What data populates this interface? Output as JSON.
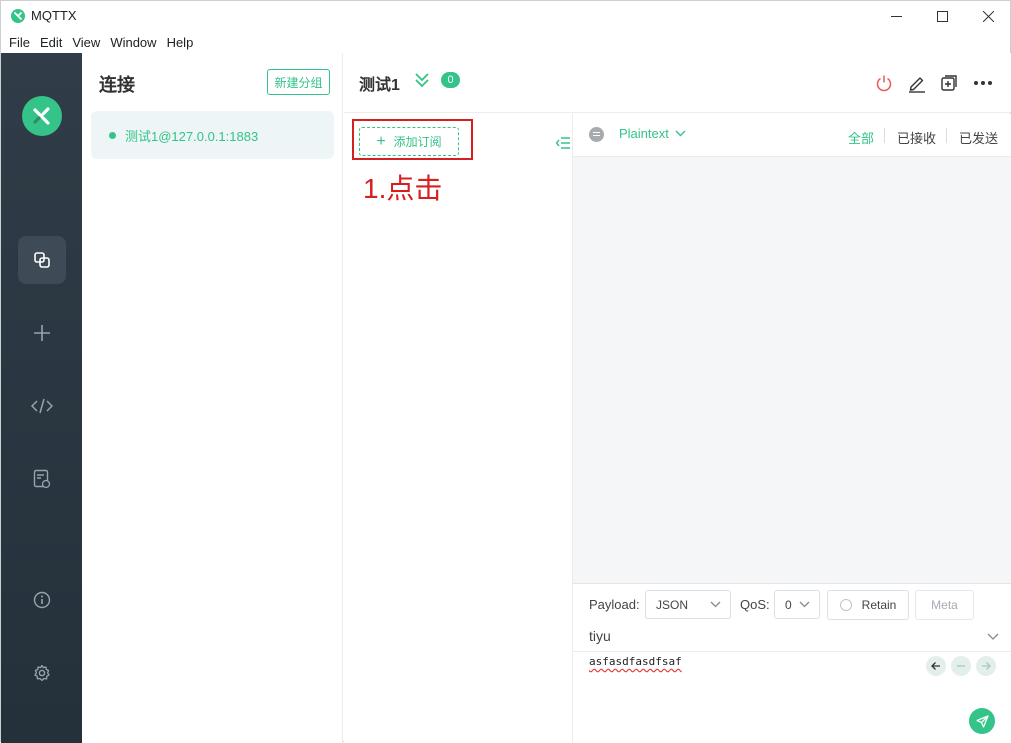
{
  "window": {
    "title": "MQTTX"
  },
  "menu": {
    "file": "File",
    "edit": "Edit",
    "view": "View",
    "window": "Window",
    "help": "Help"
  },
  "connections": {
    "header": "连接",
    "new_group_label": "新建分组",
    "items": [
      {
        "label": "测试1@127.0.0.1:1883",
        "status": "connected"
      }
    ]
  },
  "main": {
    "title": "测试1",
    "subscription_count": "0"
  },
  "subscriptions": {
    "add_label": "添加订阅"
  },
  "annotation": {
    "text": "1.点击"
  },
  "messages": {
    "format": "Plaintext",
    "filters": {
      "all": "全部",
      "received": "已接收",
      "sent": "已发送"
    },
    "active_filter": "全部"
  },
  "publish": {
    "payload_label": "Payload:",
    "payload_type": "JSON",
    "qos_label": "QoS:",
    "qos_value": "0",
    "retain_label": "Retain",
    "meta_label": "Meta",
    "topic": "tiyu",
    "payload": "asfasdfasdfsaf"
  },
  "colors": {
    "accent": "#34c388",
    "rail": "#2b3640",
    "annotation": "#d62020",
    "disconnect": "#e65b5b"
  }
}
